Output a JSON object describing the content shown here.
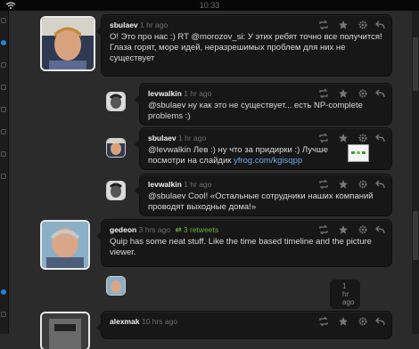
{
  "statusbar": {
    "time": "10:33"
  },
  "tweets": [
    {
      "user": "sbulaev",
      "time": "1 hr ago",
      "text": "О! Это про нас :) RT @morozov_si: У этих ребят точно все получится! Глаза горят, море идей, неразрешимых проблем для них не существует",
      "mention": "@morozov_si"
    },
    {
      "user": "levwalkin",
      "time": "1 hr ago",
      "text_pre": "@sbulaev ну как это не существует... есть NP-complete problems :)"
    },
    {
      "user": "sbulaev",
      "time": "1 hr ago",
      "text_pre": "@levwalkin Лев :) ну что за придирки :) Лучше посмотри на слайдик ",
      "link": "yfrog.com/kgisqpp"
    },
    {
      "user": "levwalkin",
      "time": "1 hr ago",
      "text_pre": "@sbulaev Cool! «Остальные сотрудники наших компаний проводят выходные дома!»"
    },
    {
      "user": "gedeon",
      "time": "3 hrs ago",
      "retweets": "3 retweets",
      "text_pre": "Quip has some neat stuff. Like the time based timeline and the picture viewer."
    },
    {
      "time": "1 hr ago"
    },
    {
      "user": "alexmak",
      "time": "10 hrs ago"
    }
  ],
  "icons": {
    "retweet": "retweet-icon",
    "favorite": "star-icon",
    "settings": "gear-icon",
    "reply": "reply-icon"
  },
  "colors": {
    "link": "#6aa8e8",
    "retweet_count": "#6fae3a",
    "accent": "#2a7fd4"
  }
}
